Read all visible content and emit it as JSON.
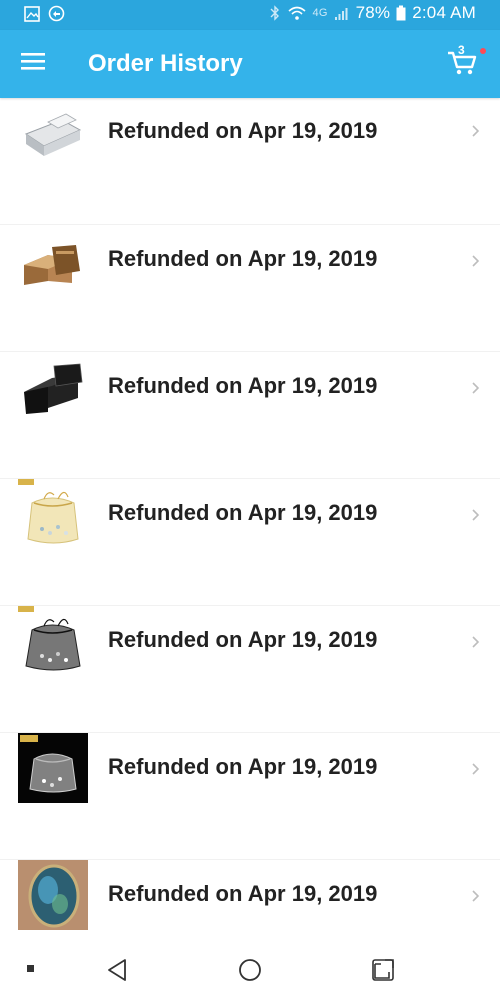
{
  "status_bar": {
    "battery": "78%",
    "time": "2:04 AM",
    "network": "4G",
    "icons": [
      "gallery-icon",
      "refresh-icon",
      "bluetooth-icon",
      "wifi-icon",
      "signal-icon",
      "battery-icon"
    ]
  },
  "app_bar": {
    "title": "Order History",
    "cart_count": "3",
    "icons": [
      "menu-icon",
      "cart-icon"
    ]
  },
  "orders": [
    {
      "label": "Refunded on Apr 19, 2019",
      "thumb": "silver-box"
    },
    {
      "label": "Refunded on Apr 19, 2019",
      "thumb": "brown-box"
    },
    {
      "label": "Refunded on Apr 19, 2019",
      "thumb": "black-box"
    },
    {
      "label": "Refunded on Apr 19, 2019",
      "thumb": "beige-organza-bag"
    },
    {
      "label": "Refunded on Apr 19, 2019",
      "thumb": "black-organza-bag"
    },
    {
      "label": "Refunded on Apr 19, 2019",
      "thumb": "white-bag-dark-bg"
    },
    {
      "label": "Refunded on Apr 19, 2019",
      "thumb": "labradorite-stone"
    }
  ],
  "nav_bar": {
    "icons": [
      "recent-dot-icon",
      "back-icon",
      "home-icon",
      "overview-icon"
    ]
  },
  "colors": {
    "status_bar": "#2ba6dd",
    "app_bar": "#34b3ea",
    "text": "#222222",
    "chevron": "#bdbdbd",
    "badge_dot": "#ff4a55"
  }
}
